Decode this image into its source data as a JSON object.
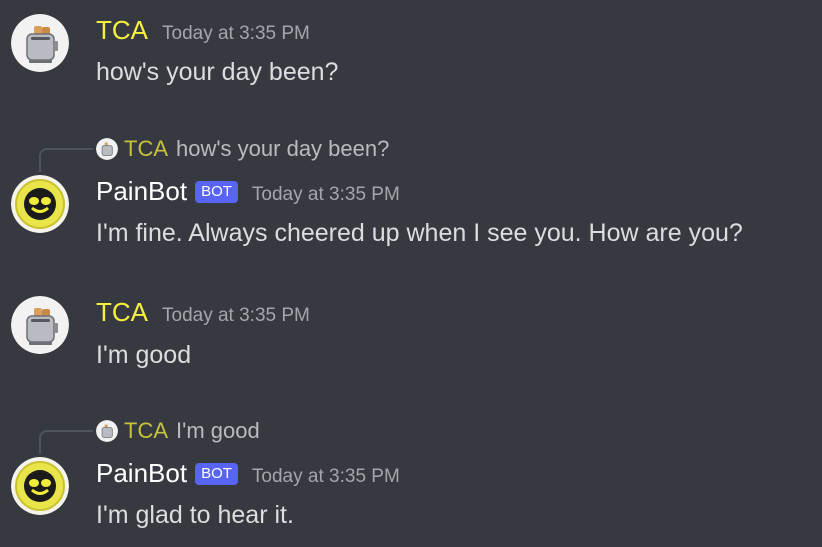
{
  "messages": [
    {
      "author": "TCA",
      "timestamp": "Today at 3:35 PM",
      "text": "how's your day been?"
    },
    {
      "reply_to": {
        "author": "TCA",
        "text": "how's your day been?"
      },
      "author": "PainBot",
      "badge": "BOT",
      "timestamp": "Today at 3:35 PM",
      "text": "I'm fine. Always cheered up when I see you. How are you?"
    },
    {
      "author": "TCA",
      "timestamp": "Today at 3:35 PM",
      "text": "I'm good"
    },
    {
      "reply_to": {
        "author": "TCA",
        "text": "I'm good"
      },
      "author": "PainBot",
      "badge": "BOT",
      "timestamp": "Today at 3:35 PM",
      "text": "I'm glad to hear it."
    }
  ],
  "colors": {
    "background": "#36393f",
    "tca_name": "#f5f03f",
    "bot_badge": "#5865f2",
    "text": "#dcddde",
    "timestamp": "#a3a6aa"
  },
  "icons": {
    "tca_avatar": "toaster-icon",
    "painbot_avatar": "smiley-face-icon"
  }
}
